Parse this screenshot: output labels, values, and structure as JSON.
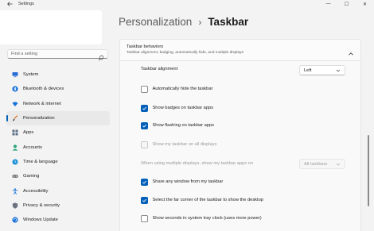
{
  "window": {
    "title": "Settings",
    "controls": {
      "minimize": "—",
      "maximize": "☐",
      "close": "✕"
    }
  },
  "search": {
    "placeholder": "Find a setting"
  },
  "sidebar": {
    "items": [
      {
        "label": "System",
        "icon": "system-icon"
      },
      {
        "label": "Bluetooth & devices",
        "icon": "bluetooth-icon"
      },
      {
        "label": "Network & internet",
        "icon": "wifi-icon"
      },
      {
        "label": "Personalization",
        "icon": "brush-icon",
        "active": true
      },
      {
        "label": "Apps",
        "icon": "apps-icon"
      },
      {
        "label": "Accounts",
        "icon": "person-icon"
      },
      {
        "label": "Time & language",
        "icon": "globe-clock-icon"
      },
      {
        "label": "Gaming",
        "icon": "gamepad-icon"
      },
      {
        "label": "Accessibility",
        "icon": "accessibility-icon"
      },
      {
        "label": "Privacy & security",
        "icon": "shield-icon"
      },
      {
        "label": "Windows Update",
        "icon": "update-icon"
      }
    ]
  },
  "breadcrumb": {
    "parent": "Personalization",
    "separator": "›",
    "current": "Taskbar"
  },
  "section": {
    "title": "Taskbar behaviors",
    "subtitle": "Taskbar alignment, badging, automatically hide, and multiple displays"
  },
  "settings": {
    "alignment_label": "Taskbar alignment",
    "alignment_value": "Left",
    "auto_hide": {
      "label": "Automatically hide the taskbar",
      "checked": false
    },
    "badges": {
      "label": "Show badges on taskbar apps",
      "checked": true
    },
    "flashing": {
      "label": "Show flashing on taskbar apps",
      "checked": true
    },
    "all_displays": {
      "label": "Show my taskbar on all displays",
      "checked": false,
      "disabled": true
    },
    "multi_display_label": "When using multiple displays, show my taskbar apps on",
    "multi_display_value": "All taskbars",
    "share_window": {
      "label": "Share any window from my taskbar",
      "checked": true
    },
    "far_corner": {
      "label": "Select the far corner of the taskbar to show the desktop",
      "checked": true
    },
    "seconds_clock": {
      "label": "Show seconds in system tray clock (uses more power)",
      "checked": false
    }
  },
  "colors": {
    "accent": "#005fb8",
    "background": "#f3f3f3",
    "card": "#fbfbfb"
  }
}
